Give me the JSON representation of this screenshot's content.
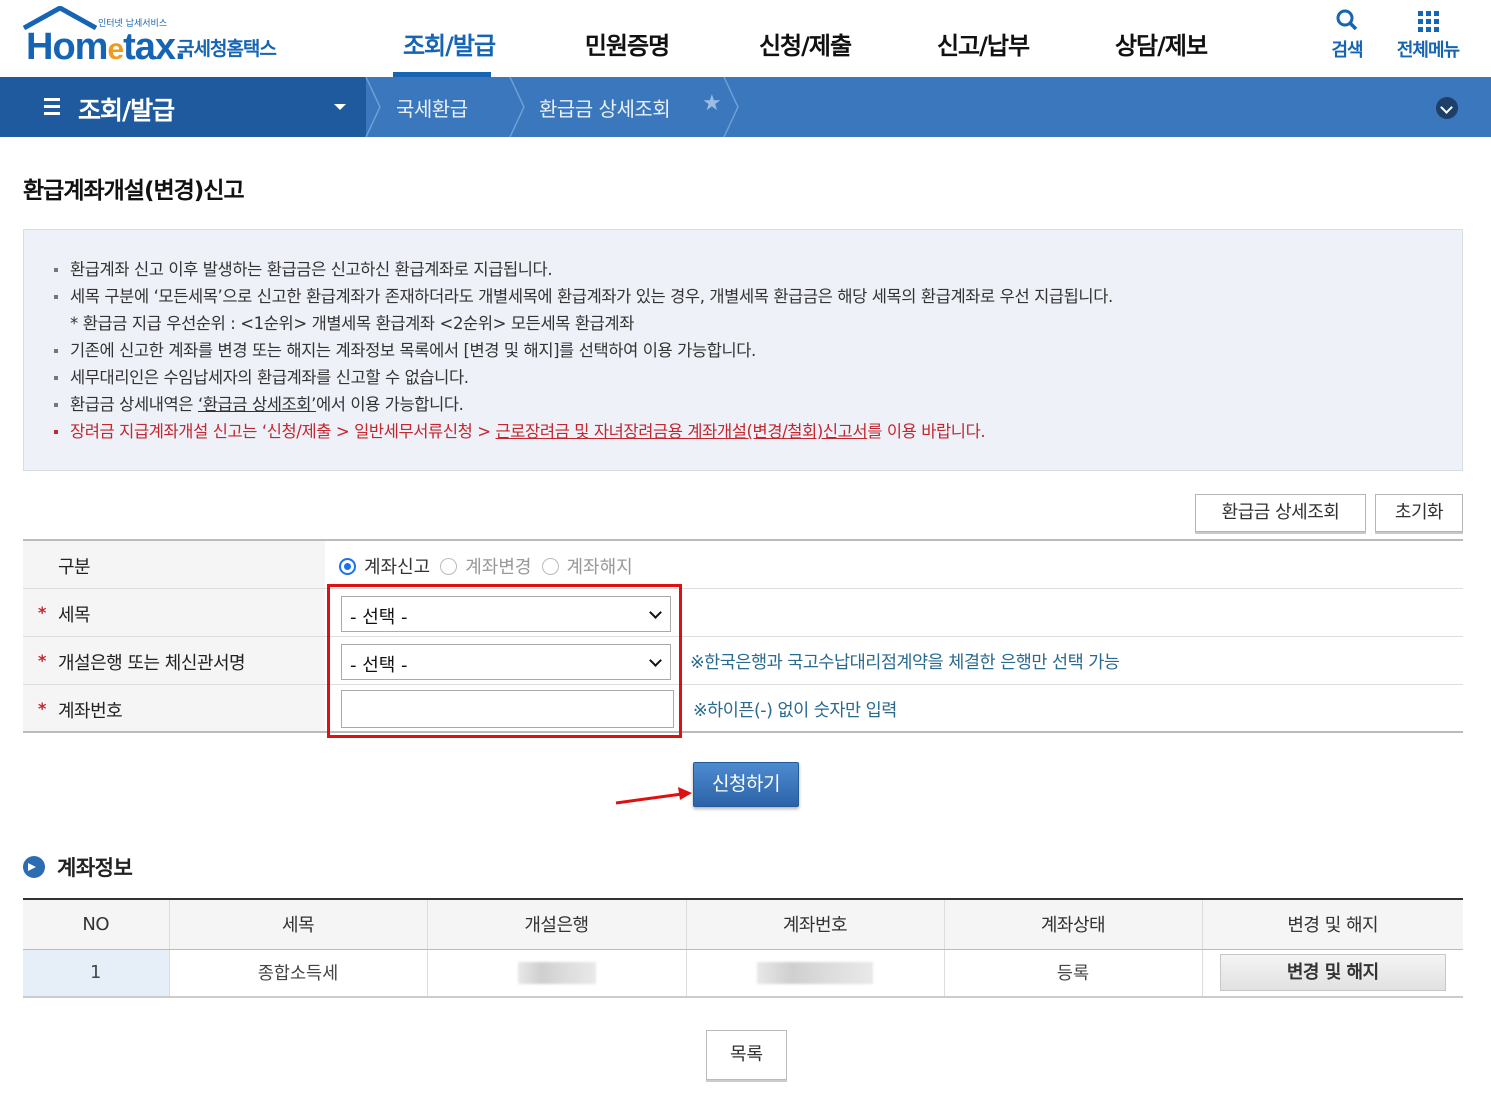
{
  "header": {
    "logo_tiny": "인터넷 납세서비스",
    "logo_main_pre": "Hom",
    "logo_main_e": "e",
    "logo_main_post": "tax.",
    "logo_sub": "국세청홈택스",
    "nav": [
      "조회/발급",
      "민원증명",
      "신청/제출",
      "신고/납부",
      "상담/제보"
    ],
    "active_nav_index": 0,
    "search_label": "검색",
    "menu_label": "전체메뉴"
  },
  "breadcrumb": {
    "home": "조회/발급",
    "level1": "국세환급",
    "level2": "환급금 상세조회",
    "favorite_icon": "star-icon"
  },
  "page": {
    "title": "환급계좌개설(변경)신고"
  },
  "notice": {
    "lines": [
      "환급계좌 신고 이후 발생하는 환급금은 신고하신 환급계좌로 지급됩니다.",
      "세목 구분에 ‘모든세목’으로 신고한 환급계좌가 존재하더라도 개별세목에 환급계좌가 있는 경우, 개별세목 환급금은 해당 세목의 환급계좌로 우선 지급됩니다.",
      "* 환급금 지급 우선순위 : <1순위> 개별세목 환급계좌  <2순위> 모든세목 환급계좌",
      "기존에 신고한 계좌를 변경 또는 해지는 계좌정보 목록에서 [변경 및 해지]를 선택하여 이용 가능합니다.",
      "세무대리인은 수임납세자의 환급계좌를 신고할 수 없습니다."
    ],
    "line6_pre": "환급금 상세내역은 ",
    "line6_link": "‘환급금 상세조회’",
    "line6_post": "에서 이용 가능합니다.",
    "line7_pre": "장려금 지급계좌개설 신고는 ‘신청/제출 > 일반세무서류신청 > ",
    "line7_link": "근로장려금 및 자녀장려금용 계좌개설(변경/철회)신고서",
    "line7_post": "를 이용 바랍니다."
  },
  "actions": {
    "detail_button": "환급금 상세조회",
    "reset_button": "초기화"
  },
  "form": {
    "type_label": "구분",
    "type_options": [
      "계좌신고",
      "계좌변경",
      "계좌해지"
    ],
    "type_selected": "계좌신고",
    "tax_label": "세목",
    "tax_value": "- 선택 -",
    "bank_label": "개설은행 또는 체신관서명",
    "bank_value": "- 선택 -",
    "bank_hint": "※한국은행과 국고수납대리점계약을 체결한 은행만 선택 가능",
    "account_label": "계좌번호",
    "account_value": "",
    "account_hint": "※하이픈(-) 없이 숫자만 입력",
    "required_mark": "*",
    "submit_button": "신청하기"
  },
  "account_info": {
    "title": "계좌정보",
    "columns": [
      "NO",
      "세목",
      "개설은행",
      "계좌번호",
      "계좌상태",
      "변경 및 해지"
    ],
    "rows": [
      {
        "no": "1",
        "tax": "종합소득세",
        "bank": "",
        "account": "",
        "status": "등록",
        "action": "변경 및 해지"
      }
    ]
  },
  "list_button": "목록",
  "colors": {
    "brand": "#1565b4",
    "lnb": "#3a77bd",
    "highlight": "#e01010",
    "required": "#c4262e"
  }
}
